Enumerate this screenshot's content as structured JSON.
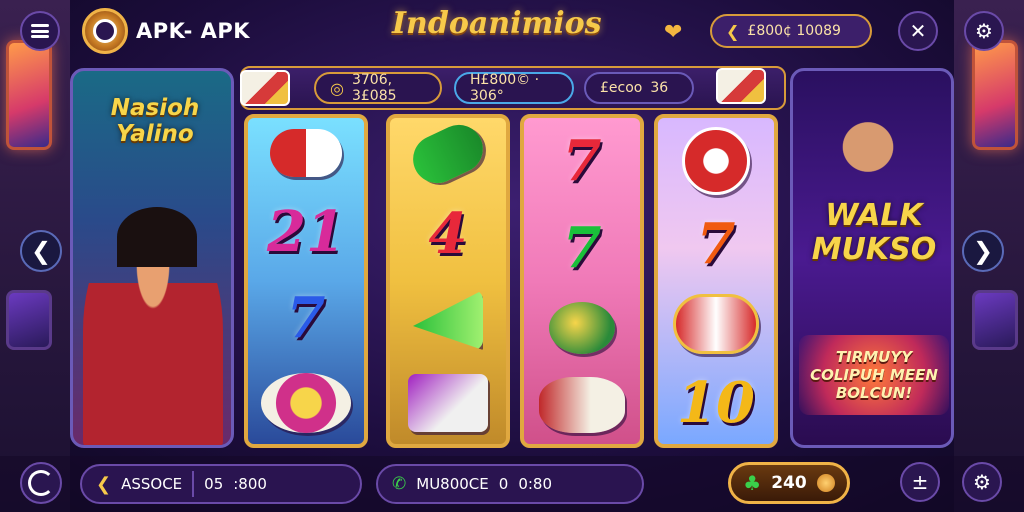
{
  "header": {
    "brand": "APK- APK",
    "title": "Indoanimios",
    "balance": "£800¢ 10089"
  },
  "reel_header": {
    "stat_1": "3706, 3£085",
    "stat_2": "H£800© · 306°",
    "stat_3_label": "£ecoo",
    "stat_3_value": "36"
  },
  "left_panel": {
    "title": "Nasioh Yalino"
  },
  "right_panel": {
    "title": "WALK MUKSO",
    "promo": "TIRMUYY COLIPUH MEEN BOLCUN!"
  },
  "reels": [
    {
      "top": "capsule-red",
      "mid": "21",
      "mid_color": "pink",
      "bottom": "7",
      "bottom_color": "blue",
      "last": "chips"
    },
    {
      "top": "capsule-green",
      "mid": "4",
      "mid_color": "red",
      "bottom": "horn-green",
      "last": "card"
    },
    {
      "top": "7",
      "top_color": "red",
      "mid": "7",
      "mid_color": "green",
      "bottom": "ball",
      "last": "drum"
    },
    {
      "top": "dice-red",
      "mid": "7",
      "mid_color": "orange",
      "bottom": "barrel",
      "last": "10"
    }
  ],
  "bottom": {
    "left_label": "ASSOCE",
    "left_code": "05",
    "left_value": ":800",
    "mid_label": "MU800CE",
    "mid_code": "0",
    "mid_value": "0:80",
    "coins": "240"
  },
  "colors": {
    "accent_gold": "#f7c94a",
    "panel_border": "#d89b3a",
    "background": "#1c0d3c"
  }
}
